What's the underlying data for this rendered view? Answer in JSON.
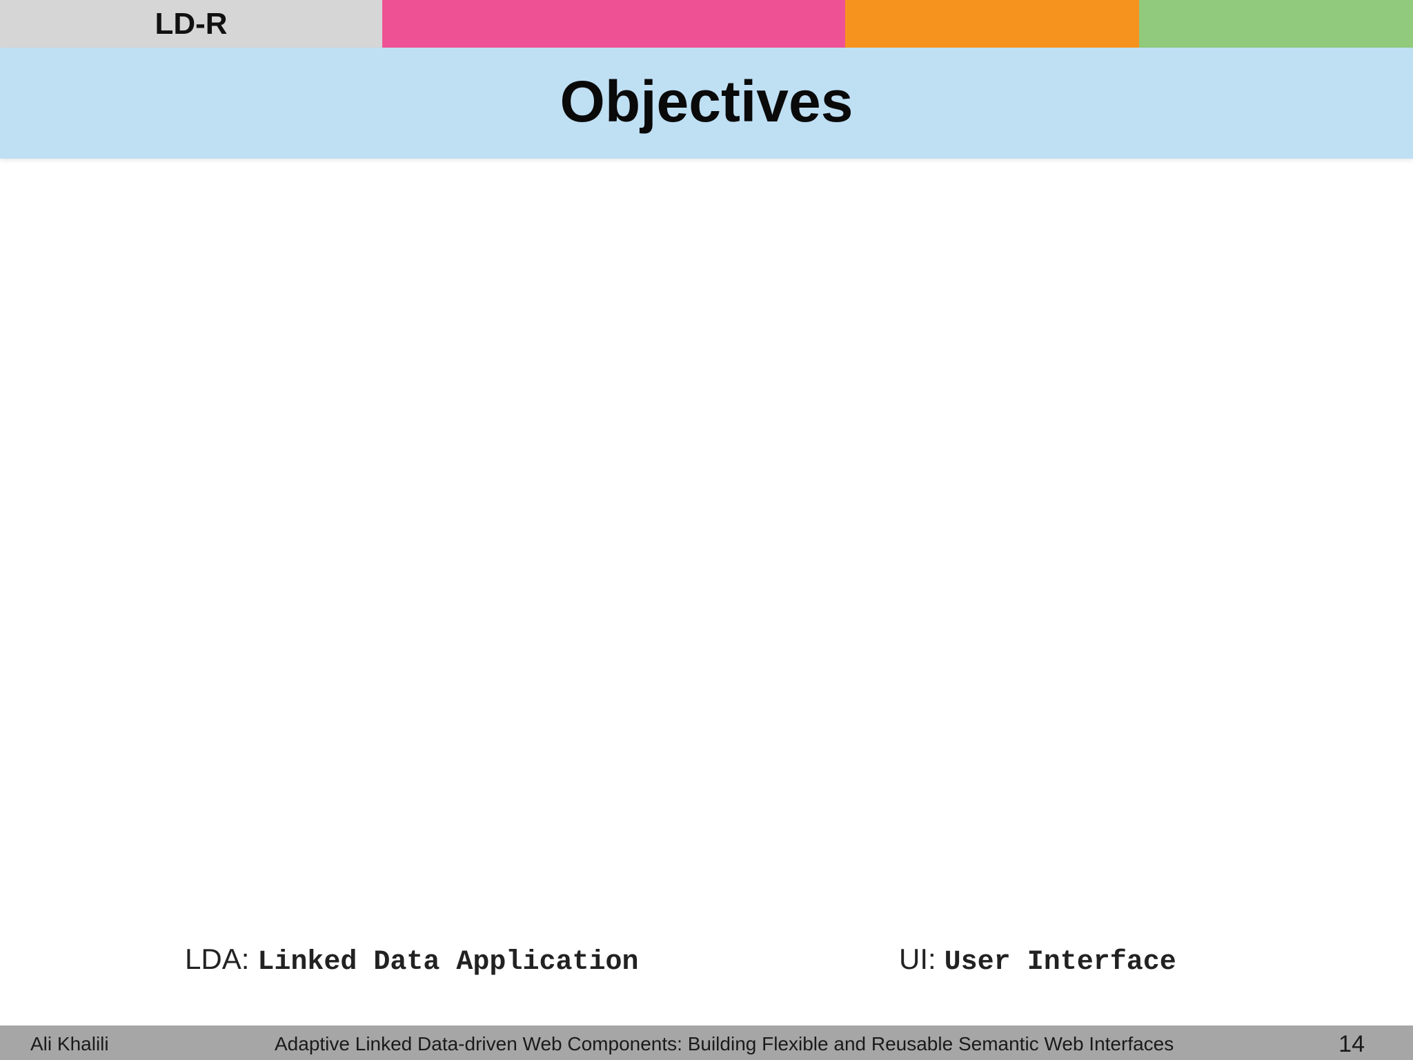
{
  "header": {
    "brand": "LD-R",
    "segment_colors": {
      "brand": "#d6d6d6",
      "pink": "#ef5294",
      "orange": "#f6921e",
      "green": "#91c97d"
    }
  },
  "slide": {
    "title": "Objectives",
    "title_band_color": "#bfdff3"
  },
  "abbreviations": [
    {
      "term": "LDA",
      "expansion": "Linked Data Application"
    },
    {
      "term": "UI",
      "expansion": "User Interface"
    }
  ],
  "footer": {
    "author": "Ali Khalili",
    "presentation_title": "Adaptive Linked Data-driven Web Components: Building Flexible and Reusable Semantic Web Interfaces",
    "page_number": "14",
    "background_color": "#a6a6a6"
  }
}
